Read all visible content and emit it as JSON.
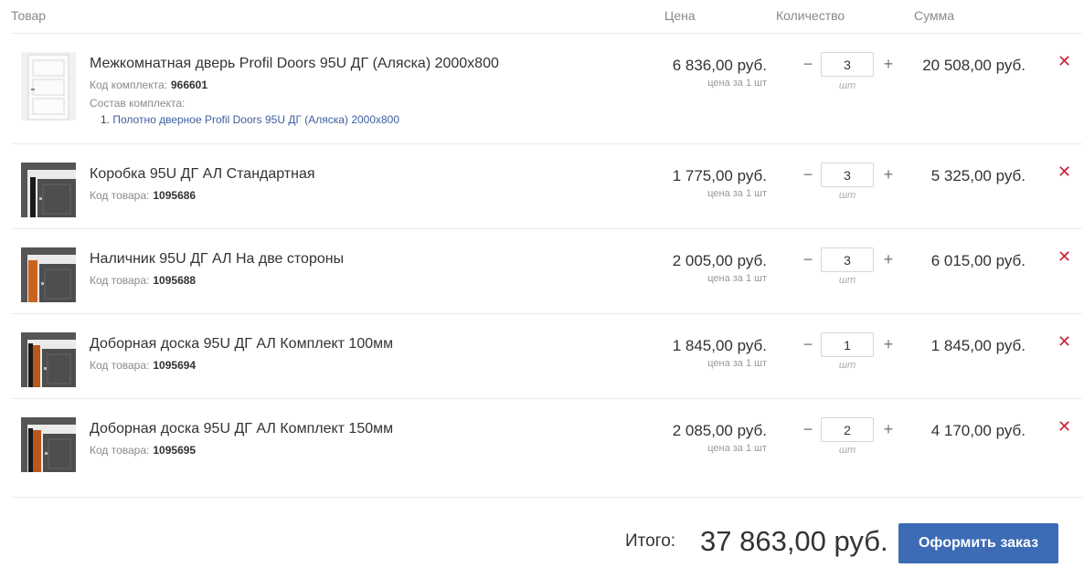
{
  "columns": {
    "product": "Товар",
    "price": "Цена",
    "quantity": "Количество",
    "sum": "Сумма"
  },
  "items": [
    {
      "name": "Межкомнатная дверь Profil Doors 95U ДГ (Аляска) 2000x800",
      "code_label": "Код комплекта:",
      "code": "966601",
      "composition_label": "Состав комплекта:",
      "composition_num": "1.",
      "composition_link": "Полотно дверное Profil Doors 95U ДГ (Аляска) 2000x800",
      "price": "6 836,00 руб.",
      "per_unit": "цена за 1 шт",
      "qty": "3",
      "unit": "шт",
      "sum": "20 508,00 руб.",
      "image": "white-door-image"
    },
    {
      "name": "Коробка 95U ДГ АЛ Стандартная",
      "code_label": "Код товара:",
      "code": "1095686",
      "price": "1 775,00 руб.",
      "per_unit": "цена за 1 шт",
      "qty": "3",
      "unit": "шт",
      "sum": "5 325,00 руб.",
      "image": "door-frame-image"
    },
    {
      "name": "Наличник 95U ДГ АЛ На две стороны",
      "code_label": "Код товара:",
      "code": "1095688",
      "price": "2 005,00 руб.",
      "per_unit": "цена за 1 шт",
      "qty": "3",
      "unit": "шт",
      "sum": "6 015,00 руб.",
      "image": "door-trim-image"
    },
    {
      "name": "Доборная доска 95U ДГ АЛ Комплект 100мм",
      "code_label": "Код товара:",
      "code": "1095694",
      "price": "1 845,00 руб.",
      "per_unit": "цена за 1 шт",
      "qty": "1",
      "unit": "шт",
      "sum": "1 845,00 руб.",
      "image": "extension-board-image"
    },
    {
      "name": "Доборная доска 95U ДГ АЛ Комплект 150мм",
      "code_label": "Код товара:",
      "code": "1095695",
      "price": "2 085,00 руб.",
      "per_unit": "цена за 1 шт",
      "qty": "2",
      "unit": "шт",
      "sum": "4 170,00 руб.",
      "image": "extension-board-image"
    }
  ],
  "icons": {
    "minus": "−",
    "plus": "+",
    "remove": "✕"
  },
  "total": {
    "label": "Итого:",
    "value": "37 863,00 руб."
  },
  "order_button": "Оформить заказ",
  "colors": {
    "accent": "#3d6bb5",
    "remove": "#cc2233",
    "link": "#3d5f9e"
  }
}
